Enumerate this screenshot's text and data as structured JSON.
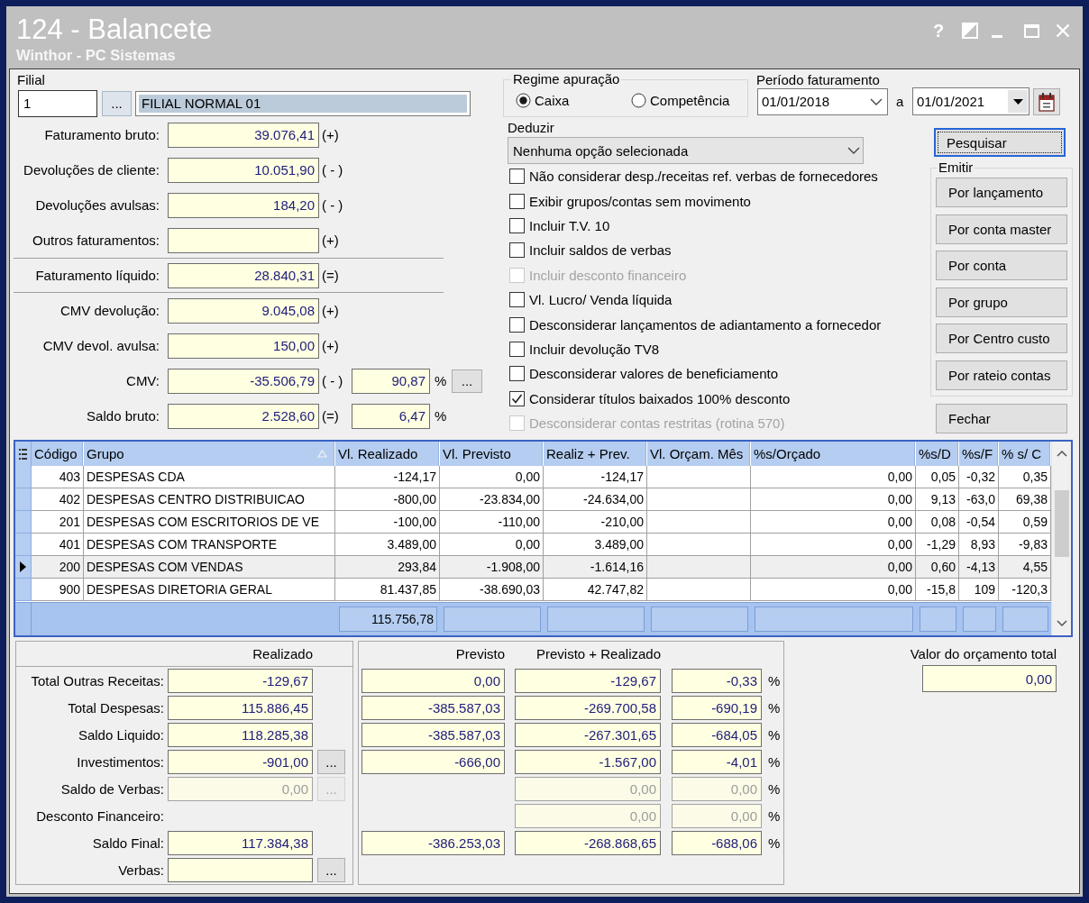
{
  "window": {
    "title": "124 - Balancete",
    "subtitle": "Winthor - PC Sistemas",
    "help": "?"
  },
  "filial": {
    "label": "Filial",
    "code": "1",
    "lookup": "...",
    "name": "FILIAL NORMAL 01"
  },
  "summary": [
    {
      "kind": "entry",
      "label": "Faturamento bruto:",
      "value": "39.076,41",
      "sign": "(+)"
    },
    {
      "kind": "entry",
      "label": "Devoluções de cliente:",
      "value": "10.051,90",
      "sign": "( - )"
    },
    {
      "kind": "entry",
      "label": "Devoluções avulsas:",
      "value": "184,20",
      "sign": "( - )"
    },
    {
      "kind": "entry",
      "label": "Outros faturamentos:",
      "sign": "(+)"
    },
    {
      "kind": "total",
      "label": "Faturamento líquido:",
      "value": "28.840,31",
      "sign": "(=)"
    },
    {
      "kind": "entry",
      "label": "CMV devolução:",
      "value": "9.045,08",
      "sign": "(+)"
    },
    {
      "kind": "entry",
      "label": "CMV devol. avulsa:",
      "value": "150,00",
      "sign": "(+)"
    },
    {
      "kind": "entry",
      "label": "CMV:",
      "value": "-35.506,79",
      "sign": "( - )",
      "percent": "90,87",
      "unit": "%",
      "lookup": "..."
    },
    {
      "kind": "entry",
      "label": "Saldo bruto:",
      "value": "2.528,60",
      "sign": "(=)",
      "percent": "6,47",
      "unit": "%"
    }
  ],
  "regime": {
    "label": "Regime apuração",
    "options": [
      {
        "label": "Caixa",
        "selected": true
      },
      {
        "label": "Competência",
        "selected": false
      }
    ]
  },
  "periodo": {
    "label": "Período faturamento",
    "start": "01/01/2018",
    "to": "a",
    "end": "01/01/2021"
  },
  "deduzir": {
    "label": "Deduzir",
    "value": "Nenhuma opção selecionada"
  },
  "options": [
    {
      "label": "Não considerar desp./receitas ref. verbas de fornecedores",
      "checked": false,
      "disabled": false
    },
    {
      "label": "Exibir grupos/contas sem movimento",
      "checked": false,
      "disabled": false
    },
    {
      "label": "Incluir T.V. 10",
      "checked": false,
      "disabled": false
    },
    {
      "label": "Incluir saldos de verbas",
      "checked": false,
      "disabled": false
    },
    {
      "label": "Incluir desconto financeiro",
      "checked": false,
      "disabled": true
    },
    {
      "label": "Vl. Lucro/ Venda líquida",
      "checked": false,
      "disabled": false
    },
    {
      "label": "Desconsiderar lançamentos de adiantamento a fornecedor",
      "checked": false,
      "disabled": false
    },
    {
      "label": "Incluir devolução TV8",
      "checked": false,
      "disabled": false
    },
    {
      "label": "Desconsiderar valores de beneficiamento",
      "checked": false,
      "disabled": false
    },
    {
      "label": "Considerar títulos baixados 100% desconto",
      "checked": true,
      "disabled": false
    },
    {
      "label": "Desconsiderar contas restritas (rotina 570)",
      "checked": false,
      "disabled": true
    }
  ],
  "search_button": {
    "label": "Pesquisar",
    "focused": true
  },
  "emitir": {
    "label": "Emitir",
    "buttons": [
      "Por lançamento",
      "Por conta master",
      "Por conta",
      "Por grupo",
      "Por Centro custo",
      "Por rateio contas"
    ]
  },
  "close_button": {
    "label": "Fechar"
  },
  "table": {
    "columns": [
      {
        "label": "Código",
        "kind": "number",
        "sorted": false,
        "footer_box": false
      },
      {
        "label": "Grupo",
        "kind": "text",
        "sorted": true,
        "footer_box": false
      },
      {
        "label": "Vl. Realizado",
        "kind": "number",
        "sorted": false,
        "footer_box": true,
        "total": "115.756,78"
      },
      {
        "label": "Vl. Previsto",
        "kind": "number",
        "sorted": false,
        "footer_box": true
      },
      {
        "label": "Realiz + Prev.",
        "kind": "number",
        "sorted": false,
        "footer_box": true
      },
      {
        "label": "Vl. Orçam. Mês",
        "kind": "number",
        "sorted": false,
        "footer_box": true
      },
      {
        "label": "%s/Orçado",
        "kind": "number",
        "sorted": false,
        "footer_box": true
      },
      {
        "label": "%s/D",
        "kind": "number",
        "sorted": false,
        "footer_box": true
      },
      {
        "label": "%s/F",
        "kind": "number",
        "sorted": false,
        "footer_box": true
      },
      {
        "label": "% s/ C",
        "kind": "number",
        "sorted": false,
        "footer_box": true
      }
    ],
    "rows": [
      {
        "selected": false,
        "cells": [
          "403",
          "DESPESAS CDA",
          "-124,17",
          "0,00",
          "-124,17",
          null,
          "0,00",
          "0,05",
          "-0,32",
          "0,35"
        ]
      },
      {
        "selected": false,
        "cells": [
          "402",
          "DESPESAS CENTRO DISTRIBUICAO",
          "-800,00",
          "-23.834,00",
          "-24.634,00",
          null,
          "0,00",
          "9,13",
          "-63,0",
          "69,38"
        ]
      },
      {
        "selected": false,
        "cells": [
          "201",
          "DESPESAS COM ESCRITORIOS DE VE",
          "-100,00",
          "-110,00",
          "-210,00",
          null,
          "0,00",
          "0,08",
          "-0,54",
          "0,59"
        ]
      },
      {
        "selected": false,
        "cells": [
          "401",
          "DESPESAS COM TRANSPORTE",
          "3.489,00",
          "0,00",
          "3.489,00",
          null,
          "0,00",
          "-1,29",
          "8,93",
          "-9,83"
        ]
      },
      {
        "selected": true,
        "cells": [
          "200",
          "DESPESAS COM VENDAS",
          "293,84",
          "-1.908,00",
          "-1.614,16",
          null,
          "0,00",
          "0,60",
          "-4,13",
          "4,55"
        ]
      },
      {
        "selected": false,
        "cells": [
          "900",
          "DESPESAS DIRETORIA GERAL",
          "81.437,85",
          "-38.690,03",
          "42.747,82",
          null,
          "0,00",
          "-15,8",
          "109",
          "-120,3"
        ]
      }
    ]
  },
  "results": {
    "headers": {
      "realizado": "Realizado",
      "previsto": "Previsto",
      "previsto_realizado": "Previsto + Realizado"
    },
    "rows": [
      {
        "label": "Total Outras Receitas:",
        "realizado": {
          "value": "-129,67",
          "disabled": false
        },
        "previsto": {
          "value": "0,00",
          "disabled": false
        },
        "previsto_realizado": {
          "value": "-129,67",
          "disabled": false
        },
        "percent": {
          "value": "-0,33",
          "disabled": false
        },
        "unit": "%"
      },
      {
        "label": "Total Despesas:",
        "realizado": {
          "value": "115.886,45",
          "disabled": false
        },
        "previsto": {
          "value": "-385.587,03",
          "disabled": false
        },
        "previsto_realizado": {
          "value": "-269.700,58",
          "disabled": false
        },
        "percent": {
          "value": "-690,19",
          "disabled": false
        },
        "unit": "%"
      },
      {
        "label": "Saldo Liquido:",
        "realizado": {
          "value": "118.285,38",
          "disabled": false
        },
        "previsto": {
          "value": "-385.587,03",
          "disabled": false
        },
        "previsto_realizado": {
          "value": "-267.301,65",
          "disabled": false
        },
        "percent": {
          "value": "-684,05",
          "disabled": false
        },
        "unit": "%"
      },
      {
        "label": "Investimentos:",
        "realizado": {
          "value": "-901,00",
          "disabled": false
        },
        "lookup": {
          "label": "...",
          "disabled": false
        },
        "previsto": {
          "value": "-666,00",
          "disabled": false
        },
        "previsto_realizado": {
          "value": "-1.567,00",
          "disabled": false
        },
        "percent": {
          "value": "-4,01",
          "disabled": false
        },
        "unit": "%"
      },
      {
        "label": "Saldo de Verbas:",
        "realizado": {
          "value": "0,00",
          "disabled": true
        },
        "lookup": {
          "label": "...",
          "disabled": true
        },
        "previsto_realizado": {
          "value": "0,00",
          "disabled": true
        },
        "percent": {
          "value": "0,00",
          "disabled": true
        },
        "unit": "%"
      },
      {
        "label": "Desconto Financeiro:",
        "previsto_realizado": {
          "value": "0,00",
          "disabled": true
        },
        "percent": {
          "value": "0,00",
          "disabled": true
        },
        "unit": "%"
      },
      {
        "label": "Saldo Final:",
        "realizado": {
          "value": "117.384,38",
          "disabled": false
        },
        "previsto": {
          "value": "-386.253,03",
          "disabled": false
        },
        "previsto_realizado": {
          "value": "-268.868,65",
          "disabled": false
        },
        "percent": {
          "value": "-688,06",
          "disabled": false
        },
        "unit": "%"
      },
      {
        "label": "Verbas:",
        "realizado": {
          "disabled": false
        },
        "lookup": {
          "label": "...",
          "disabled": false
        }
      }
    ]
  },
  "budget": {
    "label": "Valor do orçamento total",
    "value": "0,00"
  }
}
